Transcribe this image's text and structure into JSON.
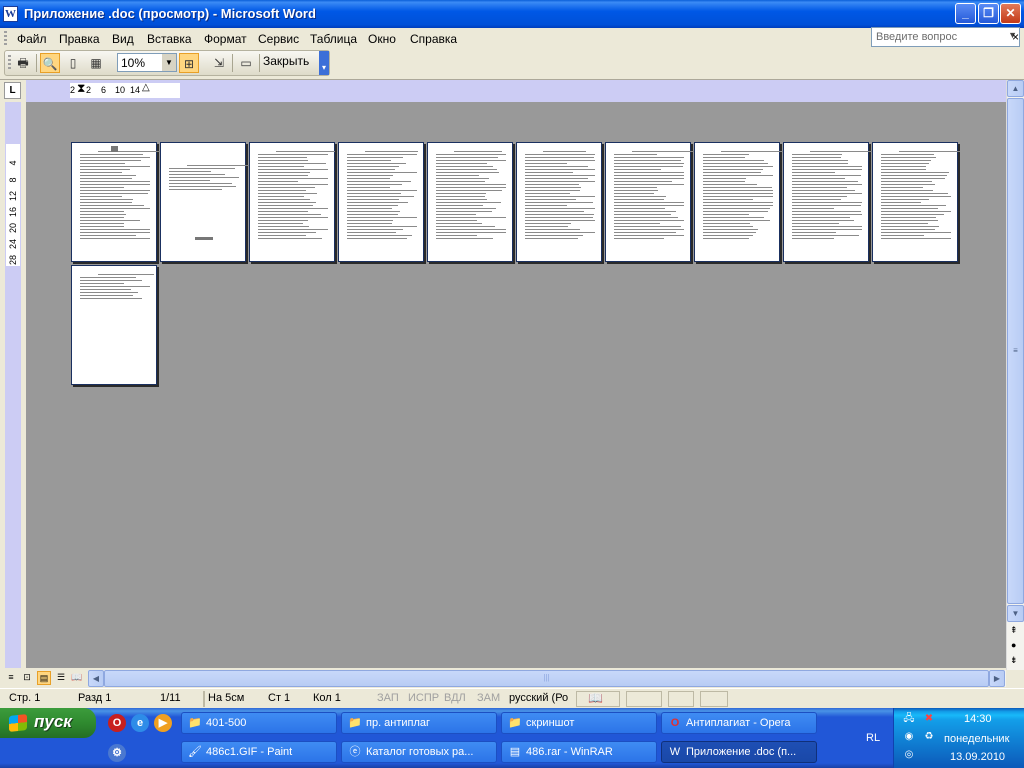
{
  "window": {
    "title": "Приложение .doc (просмотр) - Microsoft Word"
  },
  "menu": {
    "items": [
      "Файл",
      "Правка",
      "Вид",
      "Вставка",
      "Формат",
      "Сервис",
      "Таблица",
      "Окно",
      "Справка"
    ],
    "ask_placeholder": "Введите вопрос"
  },
  "toolbar": {
    "zoom": "10%",
    "close_label": "Закрыть"
  },
  "ruler": {
    "h_marks": [
      "2",
      "2",
      "6",
      "10",
      "14"
    ],
    "v_marks": [
      "4",
      "8",
      "12",
      "16",
      "20",
      "24",
      "28"
    ]
  },
  "preview": {
    "page_count": 11
  },
  "status": {
    "page": "Стр. 1",
    "section": "Разд 1",
    "pages": "1/11",
    "at": "На 5см",
    "line": "Ст 1",
    "col": "Кол 1",
    "rec": "ЗАП",
    "trk": "ИСПР",
    "ext": "ВДЛ",
    "ovr": "ЗАМ",
    "language": "русский (Ро"
  },
  "taskbar": {
    "start_label": "пуск",
    "tasks": [
      {
        "label": "401-500",
        "icon": "folder-icon"
      },
      {
        "label": "пр. антиплаг",
        "icon": "folder-icon"
      },
      {
        "label": "скриншот",
        "icon": "folder-icon"
      },
      {
        "label": "Антиплагиат - Opera",
        "icon": "opera-icon"
      },
      {
        "label": "486c1.GIF - Paint",
        "icon": "paint-icon"
      },
      {
        "label": "Каталог готовых ра...",
        "icon": "ie-icon"
      },
      {
        "label": "486.rar - WinRAR",
        "icon": "winrar-icon"
      },
      {
        "label": "Приложение .doc (п...",
        "icon": "word-icon"
      }
    ],
    "lang": "RL",
    "time": "14:30",
    "weekday": "понедельник",
    "date": "13.09.2010"
  }
}
